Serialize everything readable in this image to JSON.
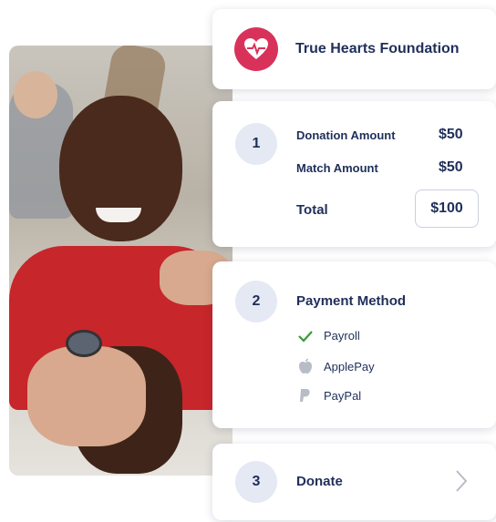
{
  "header": {
    "org_name": "True Hearts Foundation",
    "logo_icon": "heartbeat-icon",
    "accent": "#d9325a"
  },
  "step1": {
    "number": "1",
    "donation_label": "Donation Amount",
    "donation_value": "$50",
    "match_label": "Match Amount",
    "match_value": "$50",
    "total_label": "Total",
    "total_value": "$100"
  },
  "step2": {
    "number": "2",
    "title": "Payment Method",
    "options": [
      {
        "label": "Payroll",
        "icon": "check-icon",
        "selected": true
      },
      {
        "label": "ApplePay",
        "icon": "apple-icon",
        "selected": false
      },
      {
        "label": "PayPal",
        "icon": "paypal-icon",
        "selected": false
      }
    ]
  },
  "step3": {
    "number": "3",
    "title": "Donate",
    "icon": "chevron-right-icon"
  },
  "colors": {
    "navy": "#1f2f5a",
    "circle_bg": "#e4e9f3",
    "check_green": "#3a9a3a"
  }
}
